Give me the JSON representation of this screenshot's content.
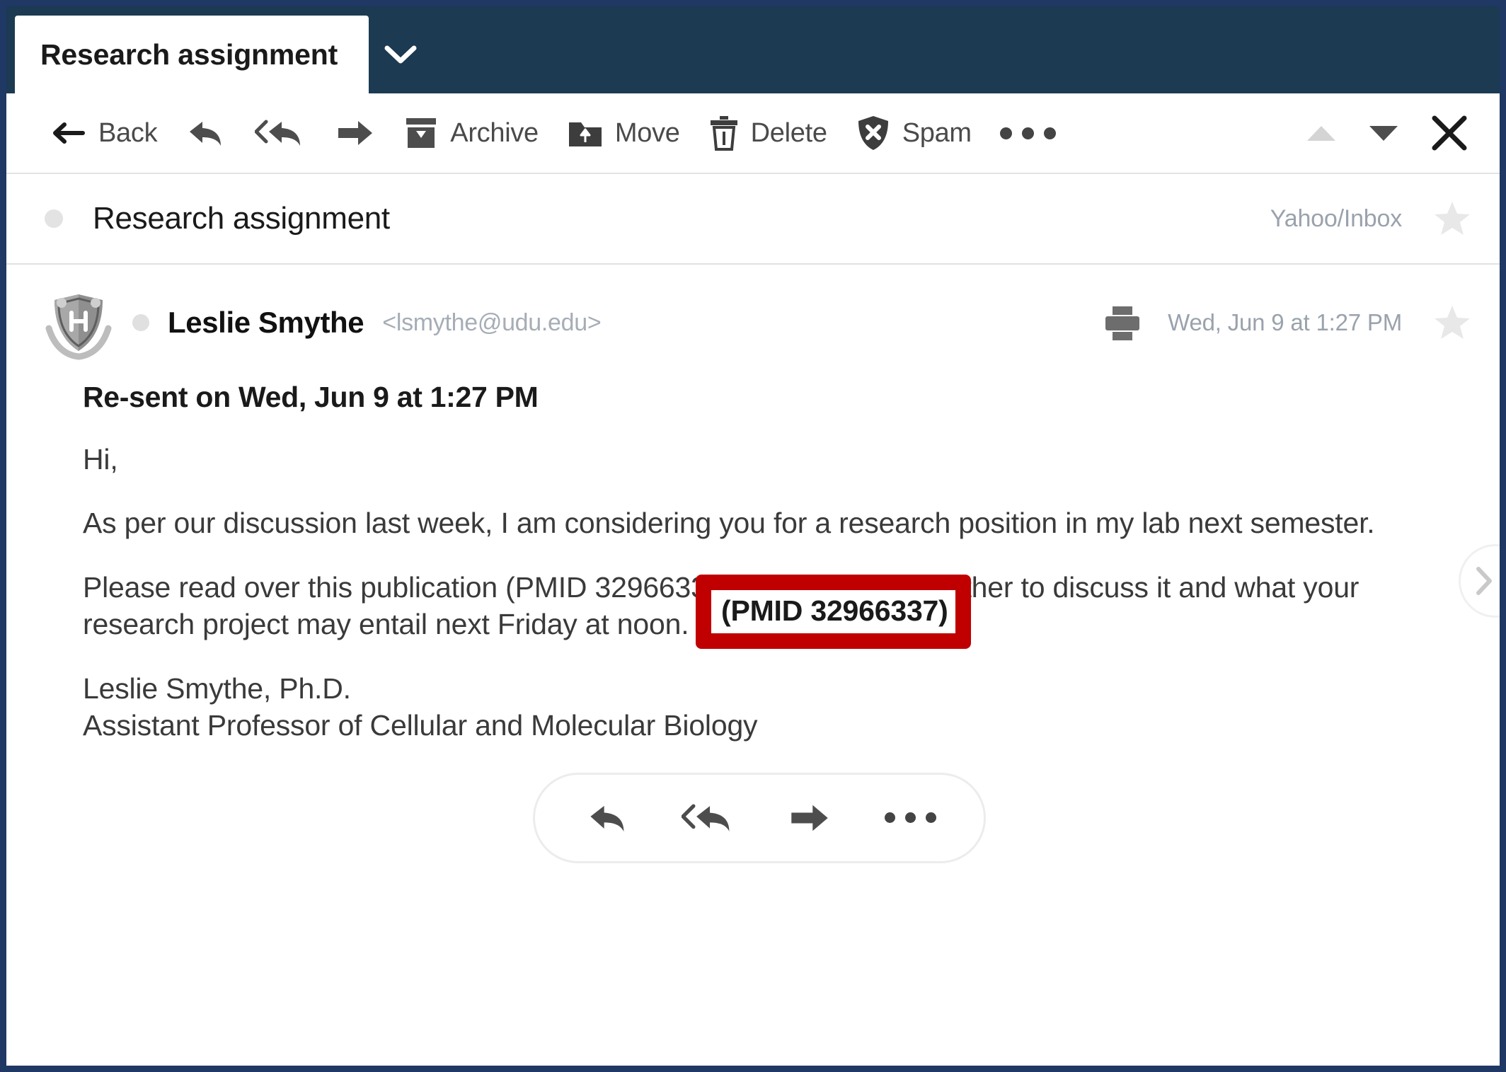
{
  "window": {
    "border_color": "#1F3864",
    "tabbar_color": "#1C3A52"
  },
  "tab": {
    "label": "Research assignment",
    "chevron_icon": "chevron-down-icon"
  },
  "toolbar": {
    "back_label": "Back",
    "reply_icon": "reply-icon",
    "reply_all_icon": "reply-all-icon",
    "forward_icon": "forward-icon",
    "archive_label": "Archive",
    "move_label": "Move",
    "delete_label": "Delete",
    "spam_label": "Spam",
    "more_icon": "more-options-icon",
    "prev_icon": "triangle-up-icon",
    "next_icon": "triangle-down-icon",
    "close_icon": "close-icon"
  },
  "subject": {
    "title": "Research assignment",
    "folder": "Yahoo/Inbox",
    "star_icon": "star-icon",
    "unread_dot": "unread-dot"
  },
  "message": {
    "avatar_icon": "university-crest-avatar",
    "sender_name": "Leslie Smythe",
    "sender_email": "<lsmythe@udu.edu>",
    "print_icon": "print-icon",
    "timestamp": "Wed, Jun 9 at 1:27 PM",
    "star_icon": "star-icon",
    "resent_line": "Re-sent on Wed, Jun 9 at 1:27 PM",
    "greeting": "Hi,",
    "paragraph_1": "As per our discussion last week, I am considering you for a research position in my lab next semester.",
    "paragraph_2": "Please read over this publication (PMID 32966337) and we’ll get together to discuss it and what your research project may entail next Friday at noon.",
    "signature_name": "Leslie Smythe, Ph.D.",
    "signature_title": "Assistant Professor of Cellular and Molecular Biology"
  },
  "highlight": {
    "text": "(PMID 32966337)",
    "border_color": "#C00000"
  },
  "bottom_actions": {
    "reply_icon": "reply-icon",
    "reply_all_icon": "reply-all-icon",
    "forward_icon": "forward-icon",
    "more_icon": "more-options-icon"
  },
  "next_button": {
    "icon": "chevron-right-icon"
  }
}
